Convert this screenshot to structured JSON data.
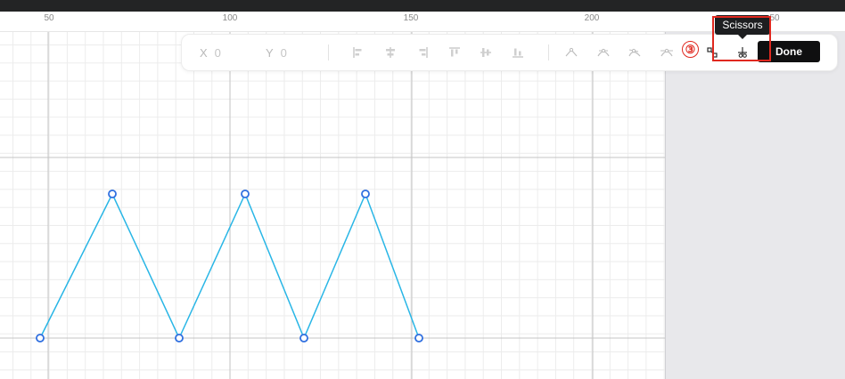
{
  "ruler": {
    "labels": [
      "50",
      "100",
      "150",
      "200",
      "50"
    ]
  },
  "toolbar": {
    "x_label": "X",
    "x_value": "0",
    "y_label": "Y",
    "y_value": "0",
    "align_icons": [
      "align-left-icon",
      "align-center-horizontal-icon",
      "align-right-icon",
      "align-top-icon",
      "align-center-vertical-icon",
      "align-bottom-icon"
    ],
    "curve_icons": [
      "corner-point-icon",
      "smooth-point-icon",
      "asymmetric-point-icon",
      "mirrored-point-icon"
    ],
    "badge": "③",
    "scissors_tooltip": "Scissors",
    "done_label": "Done"
  },
  "path": {
    "stroke_color": "#29b6e6",
    "node_color": "#2f6fe0"
  },
  "colors": {
    "highlight": "#e0281f",
    "done_bg": "#0f0f10",
    "panel_bg": "#e8e8eb"
  }
}
